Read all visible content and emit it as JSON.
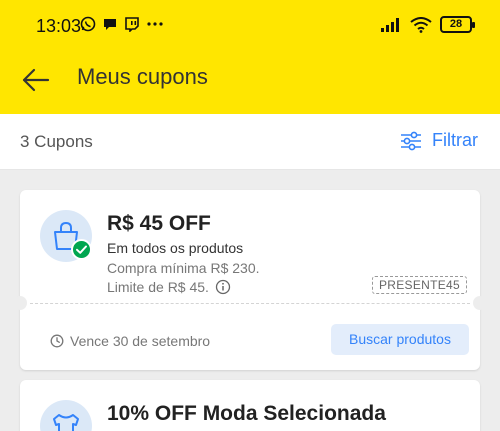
{
  "status_bar": {
    "time": "13:03",
    "left_icons": [
      "whatsapp-icon",
      "chat-bubble-icon",
      "twitch-icon",
      "more-dots-icon"
    ],
    "right_icons": [
      "signal-icon",
      "wifi-icon"
    ],
    "battery": "28"
  },
  "app_bar": {
    "back_icon": "arrow-left-icon",
    "title": "Meus cupons"
  },
  "sub_bar": {
    "count_label": "3 Cupons",
    "filter_label": "Filtrar",
    "filter_icon": "sliders-icon"
  },
  "coupons": [
    {
      "title": "R$ 45 OFF",
      "subtitle": "Em todos os produtos",
      "min_purchase": "Compra mínima R$ 230.",
      "limit": "Limite de R$ 45.",
      "code": "PRESENTE45",
      "expires": "Vence 30 de setembro",
      "action_label": "Buscar produtos",
      "icon": "shopping-bag-icon",
      "badge_icon": "check-icon"
    },
    {
      "title": "10% OFF Moda Selecionada",
      "icon": "tshirt-icon"
    }
  ],
  "colors": {
    "brand_yellow": "#ffe600",
    "accent_blue": "#3483fa",
    "success_green": "#00a650"
  }
}
